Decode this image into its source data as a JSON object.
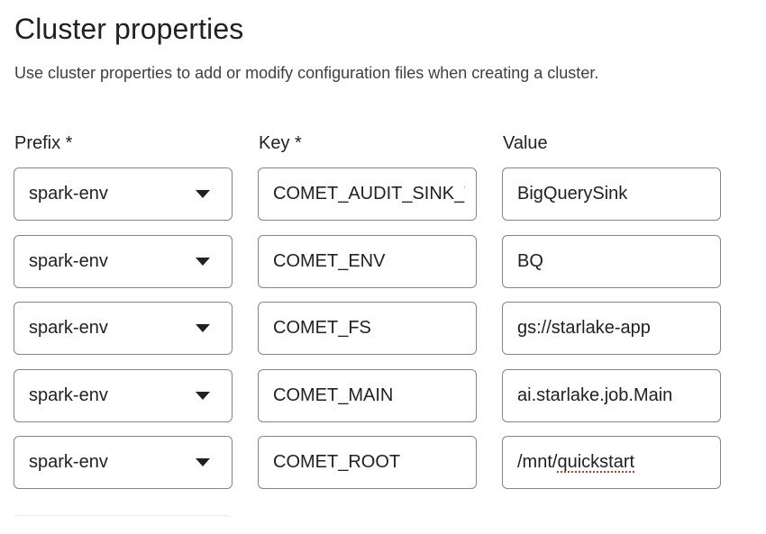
{
  "header": {
    "title": "Cluster properties",
    "description": "Use cluster properties to add or modify configuration files when creating a cluster."
  },
  "columns": {
    "prefix": "Prefix *",
    "key": "Key *",
    "value": "Value"
  },
  "properties": [
    {
      "prefix": "spark-env",
      "key": "COMET_AUDIT_SINK_TYPE",
      "value": "BigQuerySink"
    },
    {
      "prefix": "spark-env",
      "key": "COMET_ENV",
      "value": "BQ"
    },
    {
      "prefix": "spark-env",
      "key": "COMET_FS",
      "value": "gs://starlake-app"
    },
    {
      "prefix": "spark-env",
      "key": "COMET_MAIN",
      "value": "ai.starlake.job.Main"
    },
    {
      "prefix": "spark-env",
      "key": "COMET_ROOT",
      "value_prefix": "/mnt/",
      "value_misspelled": "quickstart"
    }
  ],
  "icons": {
    "dropdown": "arrow-drop-down-icon"
  },
  "colors": {
    "border": "#80868b",
    "text": "#202124",
    "spellcheck": "#d93025"
  }
}
